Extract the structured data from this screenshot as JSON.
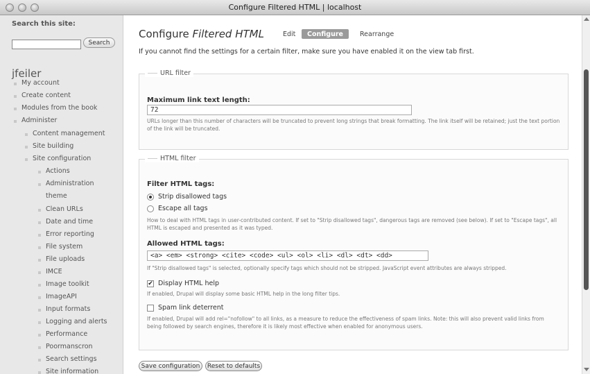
{
  "window": {
    "title": "Configure Filtered HTML | localhost"
  },
  "sidebar": {
    "search_label": "Search this site:",
    "search_value": "",
    "search_button": "Search",
    "username": "jfeiler",
    "items": [
      "My account",
      "Create content",
      "Modules from the book",
      "Administer",
      "Content management",
      "Site building",
      "Site configuration",
      "Actions",
      "Administration",
      "theme",
      "Clean URLs",
      "Date and time",
      "Error reporting",
      "File system",
      "File uploads",
      "IMCE",
      "Image toolkit",
      "ImageAPI",
      "Input formats",
      "Logging and alerts",
      "Performance",
      "Poormanscron",
      "Search settings",
      "Site information"
    ]
  },
  "main": {
    "title_prefix": "Configure ",
    "title_em": "Filtered HTML",
    "tabs": [
      {
        "label": "Edit"
      },
      {
        "label": "Configure"
      },
      {
        "label": "Rearrange"
      }
    ],
    "intro": "If you cannot find the settings for a certain filter, make sure you have enabled it on the view tab first.",
    "url_filter": {
      "legend": "URL filter",
      "label": "Maximum link text length:",
      "value": "72",
      "description": "URLs longer than this number of characters will be truncated to prevent long strings that break formatting. The link itself will be retained; just the text portion of the link will be truncated."
    },
    "html_filter": {
      "legend": "HTML filter",
      "filter_label": "Filter HTML tags:",
      "options": [
        "Strip disallowed tags",
        "Escape all tags"
      ],
      "options_desc": "How to deal with HTML tags in user-contributed content. If set to \"Strip disallowed tags\", dangerous tags are removed (see below). If set to \"Escape tags\", all HTML is escaped and presented as it was typed.",
      "allowed_label": "Allowed HTML tags:",
      "allowed_value": "<a> <em> <strong> <cite> <code> <ul> <ol> <li> <dl> <dt> <dd>",
      "allowed_desc": "If \"Strip disallowed tags\" is selected, optionally specify tags which should not be stripped. JavaScript event attributes are always stripped.",
      "display_help_label": "Display HTML help",
      "display_help_desc": "If enabled, Drupal will display some basic HTML help in the long filter tips.",
      "spam_label": "Spam link deterrent",
      "spam_desc": "If enabled, Drupal will add rel=\"nofollow\" to all links, as a measure to reduce the effectiveness of spam links. Note: this will also prevent valid links from being followed by search engines, therefore it is likely most effective when enabled for anonymous users."
    },
    "save_button": "Save configuration",
    "reset_button": "Reset to defaults"
  }
}
